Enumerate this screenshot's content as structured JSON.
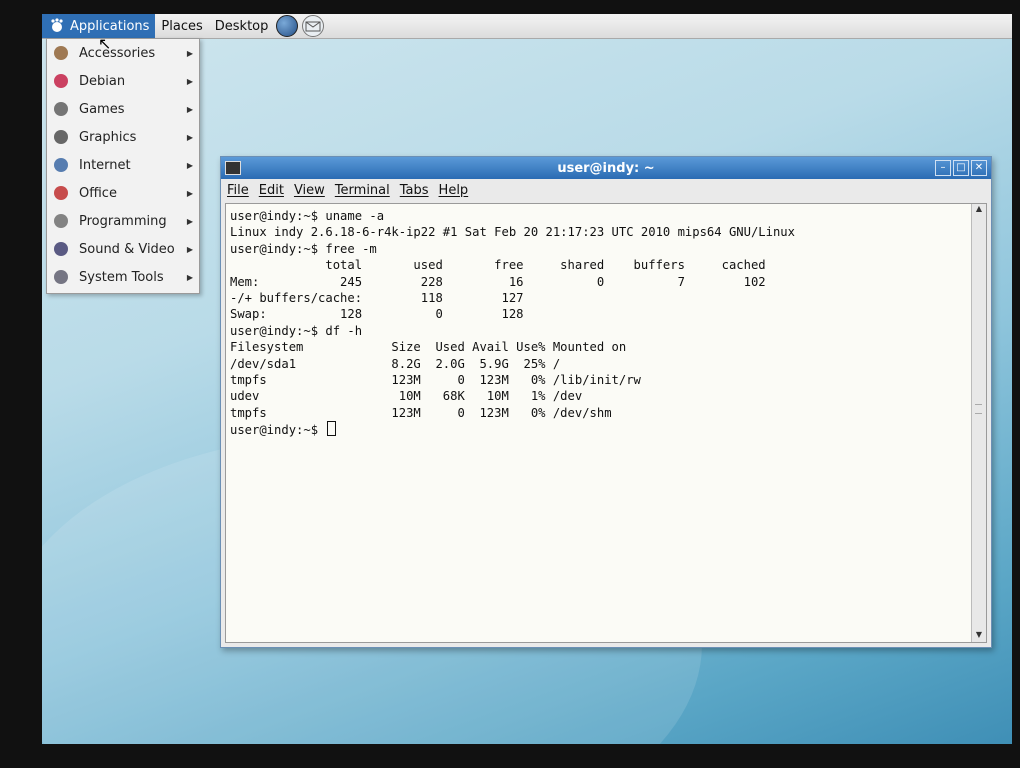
{
  "panel": {
    "applications": "Applications",
    "places": "Places",
    "desktop": "Desktop",
    "launchers": [
      {
        "icon": "browser-icon"
      },
      {
        "icon": "mail-icon"
      }
    ]
  },
  "app_menu": {
    "items": [
      {
        "label": "Accessories",
        "icon": "accessories-icon"
      },
      {
        "label": "Debian",
        "icon": "debian-icon"
      },
      {
        "label": "Games",
        "icon": "games-icon"
      },
      {
        "label": "Graphics",
        "icon": "graphics-icon"
      },
      {
        "label": "Internet",
        "icon": "internet-icon"
      },
      {
        "label": "Office",
        "icon": "office-icon"
      },
      {
        "label": "Programming",
        "icon": "programming-icon"
      },
      {
        "label": "Sound & Video",
        "icon": "sound-video-icon"
      },
      {
        "label": "System Tools",
        "icon": "system-tools-icon"
      }
    ]
  },
  "terminal": {
    "title": "user@indy: ~",
    "menus": [
      "File",
      "Edit",
      "View",
      "Terminal",
      "Tabs",
      "Help"
    ],
    "lines": [
      "user@indy:~$ uname -a",
      "Linux indy 2.6.18-6-r4k-ip22 #1 Sat Feb 20 21:17:23 UTC 2010 mips64 GNU/Linux",
      "user@indy:~$ free -m",
      "             total       used       free     shared    buffers     cached",
      "Mem:           245        228         16          0          7        102",
      "-/+ buffers/cache:        118        127",
      "Swap:          128          0        128",
      "user@indy:~$ df -h",
      "Filesystem            Size  Used Avail Use% Mounted on",
      "/dev/sda1             8.2G  2.0G  5.9G  25% /",
      "tmpfs                 123M     0  123M   0% /lib/init/rw",
      "udev                   10M   68K   10M   1% /dev",
      "tmpfs                 123M     0  123M   0% /dev/shm",
      "user@indy:~$ "
    ]
  },
  "colors": {
    "panel_active": "#2f6fb5",
    "titlebar": "#2a6bb3",
    "terminal_bg": "#fbfbf6"
  }
}
